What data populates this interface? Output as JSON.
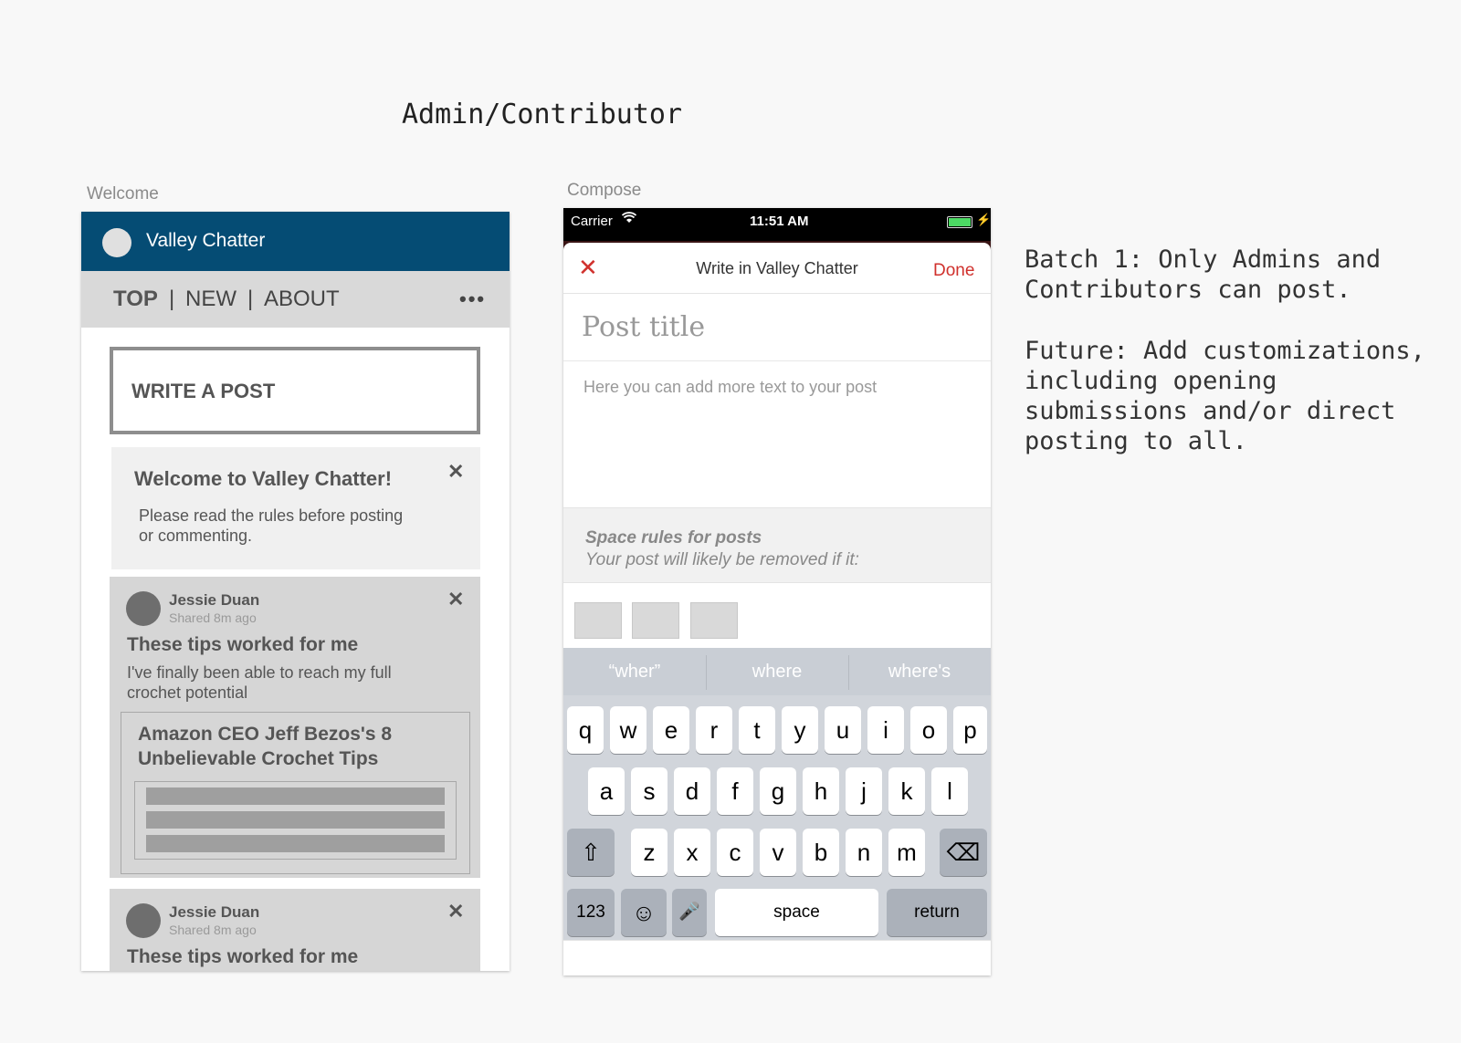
{
  "heading": "Admin/Contributor",
  "welcome": {
    "frame_label": "Welcome",
    "header_title": "Valley Chatter",
    "nav": {
      "top": "TOP",
      "separator": "|",
      "new": "NEW",
      "about": "ABOUT",
      "more": "•••"
    },
    "write_post": "WRITE A POST",
    "welcome_card": {
      "title": "Welcome to Valley Chatter!",
      "body": "Please read the rules before posting or commenting.",
      "close": "✕"
    },
    "posts": [
      {
        "author": "Jessie Duan",
        "time": "Shared 8m ago",
        "title": "These tips worked for me",
        "body": "I've finally been able to reach my full crochet potential",
        "link_title": "Amazon CEO Jeff Bezos's 8 Unbelievable Crochet Tips",
        "close": "✕"
      },
      {
        "author": "Jessie Duan",
        "time": "Shared 8m ago",
        "title": "These tips worked for me",
        "close": "✕"
      }
    ]
  },
  "compose": {
    "frame_label": "Compose",
    "status": {
      "carrier": "Carrier",
      "wifi": "wifi-icon",
      "time": "11:51 AM",
      "bolt": "⚡"
    },
    "header": {
      "close": "✕",
      "title": "Write in Valley Chatter",
      "done": "Done"
    },
    "title_placeholder": "Post title",
    "body_placeholder": "Here you can add more text to your post",
    "rules": {
      "title": "Space rules for posts",
      "body": "Your post will likely be removed if it:"
    },
    "suggestions": [
      "“wher”",
      "where",
      "where's"
    ],
    "keys": {
      "row1": [
        "q",
        "w",
        "e",
        "r",
        "t",
        "y",
        "u",
        "i",
        "o",
        "p"
      ],
      "row2": [
        "a",
        "s",
        "d",
        "f",
        "g",
        "h",
        "j",
        "k",
        "l"
      ],
      "row3": [
        "z",
        "x",
        "c",
        "v",
        "b",
        "n",
        "m"
      ],
      "shift": "⇧",
      "delete": "⌫",
      "numbers": "123",
      "emoji": "☺",
      "mic": "🎤",
      "space": "space",
      "return": "return"
    }
  },
  "notes": {
    "batch": "Batch 1: Only Admins and\nContributors can post.",
    "future": "Future: Add customizations,\nincluding opening\nsubmissions and/or direct\nposting to all."
  }
}
